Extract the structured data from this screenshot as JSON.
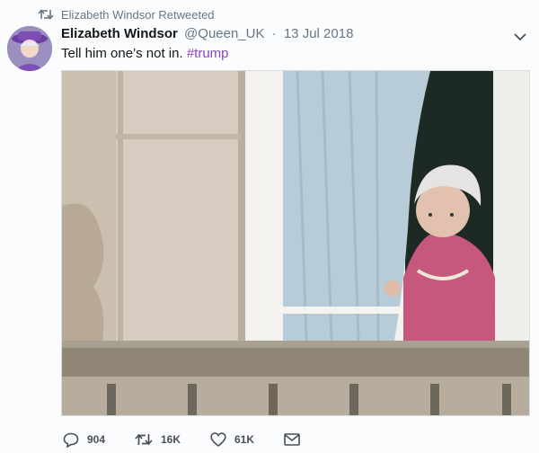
{
  "retweet_context": {
    "label": "Elizabeth Windsor Retweeted",
    "icon": "retweet-icon"
  },
  "author": {
    "display_name": "Elizabeth Windsor",
    "handle": "@Queen_UK",
    "separator": "·",
    "date": "13 Jul 2018"
  },
  "text": {
    "body": "Tell him one’s not in.",
    "hashtag": "#trump"
  },
  "media": {
    "description_icon": "photo"
  },
  "actions": {
    "reply": {
      "icon": "reply-icon",
      "count": "904"
    },
    "retweet": {
      "icon": "retweet-icon",
      "count": "16K"
    },
    "like": {
      "icon": "heart-icon",
      "count": "61K"
    },
    "dm": {
      "icon": "envelope-icon"
    }
  },
  "colors": {
    "hashtag": "#8a46c8",
    "muted": "#657786"
  }
}
